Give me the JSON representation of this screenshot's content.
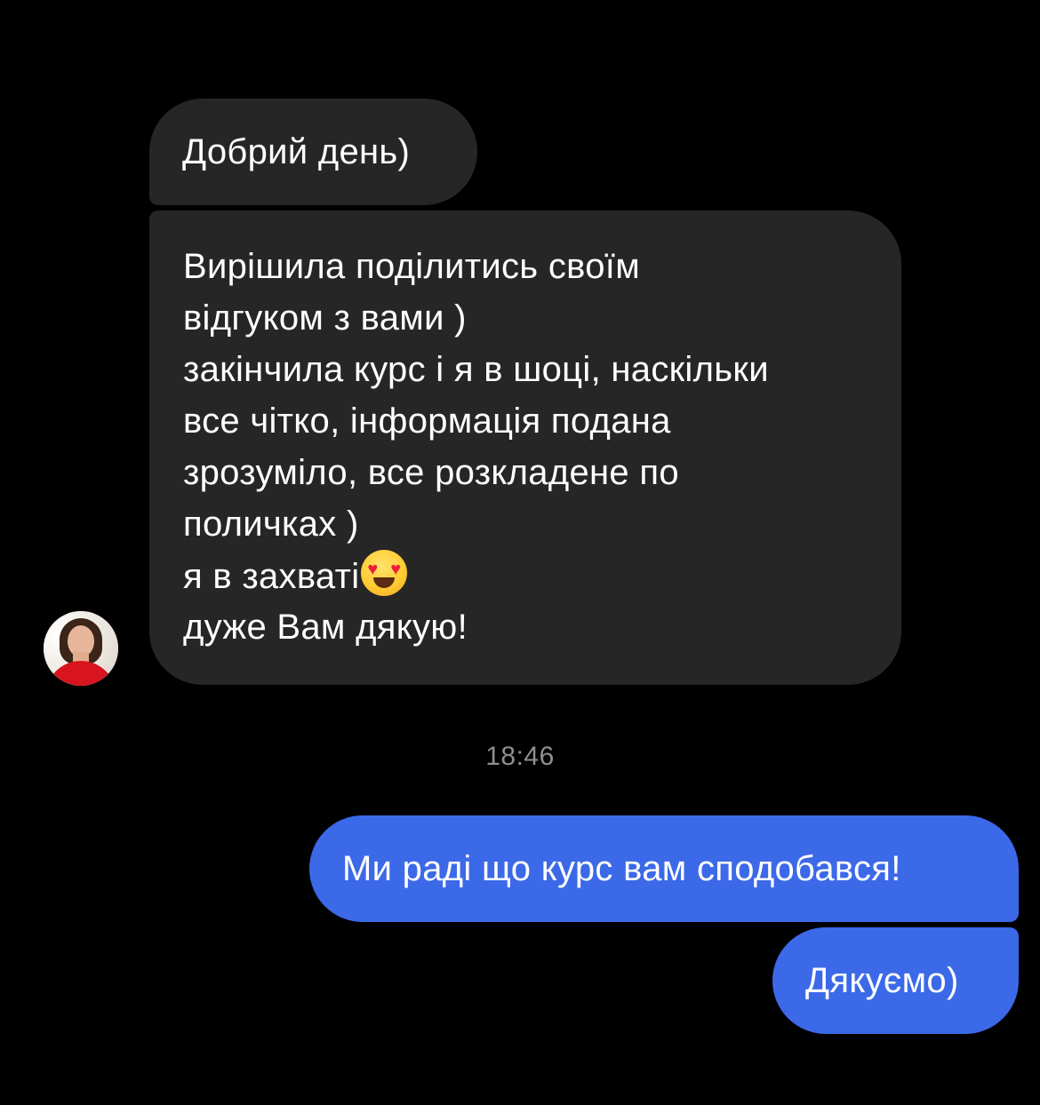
{
  "incoming": {
    "message_1": "Добрий день)",
    "message_2_lines": [
      "Вирішила поділитись своїм",
      "відгуком з вами )",
      "закінчила курс і я в шоці, наскільки",
      "все чітко, інформація подана",
      "зрозуміло, все розкладене по",
      "поличках )",
      "я в захваті",
      "дуже Вам дякую!"
    ],
    "emoji": "smiling-face-with-heart-eyes"
  },
  "timestamp": "18:46",
  "outgoing": {
    "message_1": "Ми раді що курс вам сподобався!",
    "message_2": "Дякуємо)"
  },
  "colors": {
    "background": "#000000",
    "incoming_bubble": "#262626",
    "outgoing_bubble": "#3b69e8",
    "timestamp_text": "#8e8e8e"
  }
}
